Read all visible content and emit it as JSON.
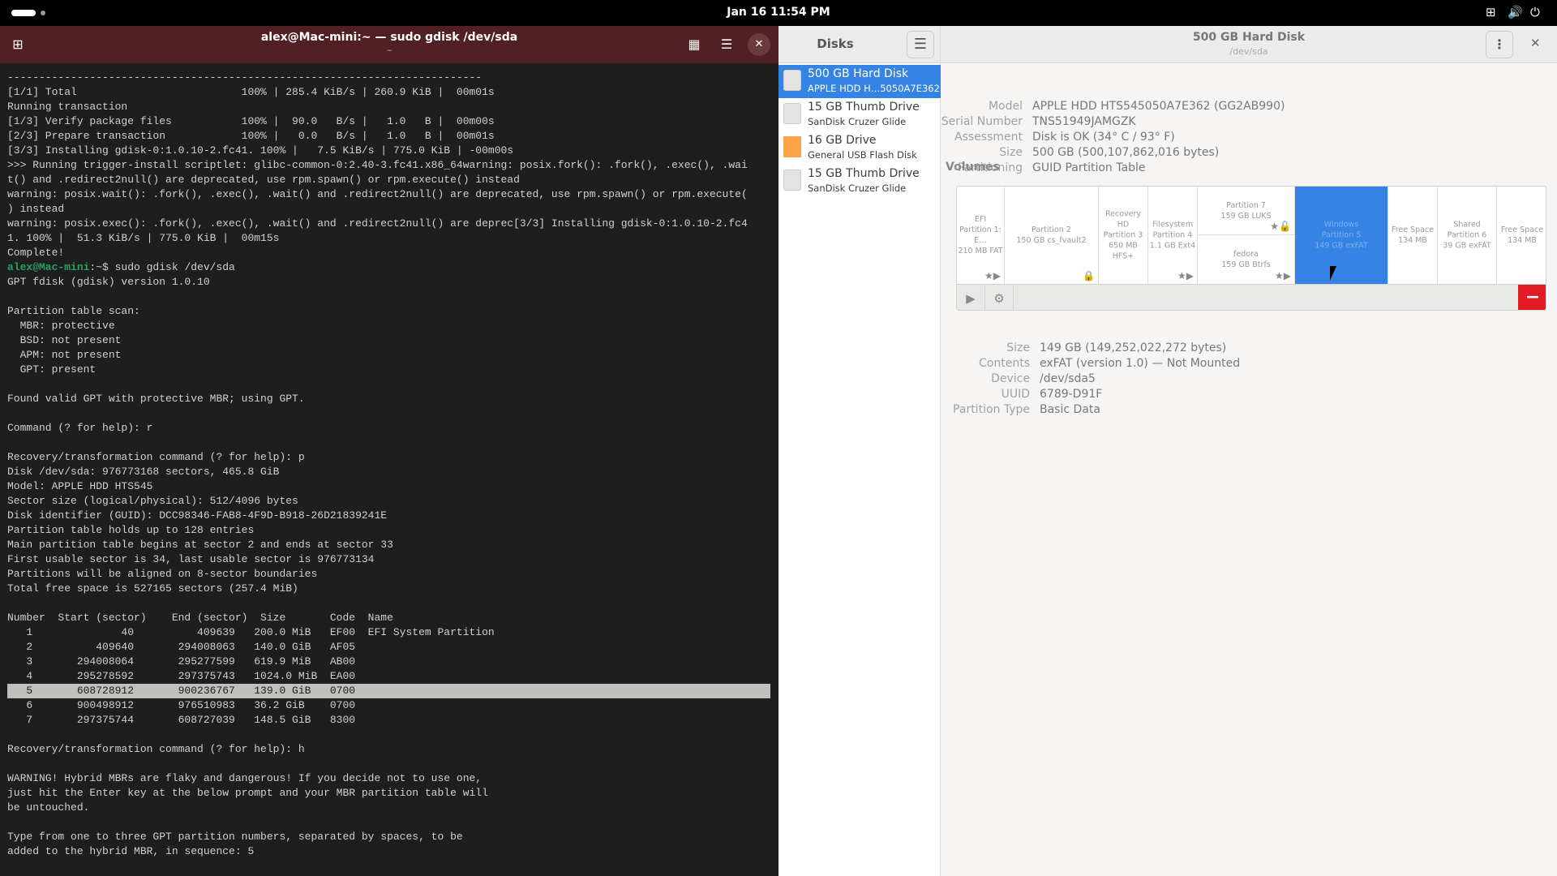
{
  "topbar": {
    "clock": "Jan 16  11:54 PM",
    "icons": [
      "activities-pill",
      "network-icon",
      "volume-icon",
      "power-icon"
    ]
  },
  "terminal": {
    "title": "alex@Mac-mini:~ — sudo gdisk /dev/sda",
    "subtitle": "~",
    "colors": {
      "titlebar": "#521f25",
      "background": "#1e1e1e",
      "prompt": "#26a269"
    },
    "lines": [
      "---------------------------------------------------------------------------",
      "[1/1] Total                          100% | 285.4 KiB/s | 260.9 KiB |  00m01s",
      "Running transaction",
      "[1/3] Verify package files           100% |  90.0   B/s |   1.0   B |  00m00s",
      "[2/3] Prepare transaction            100% |   0.0   B/s |   1.0   B |  00m01s",
      "[3/3] Installing gdisk-0:1.0.10-2.fc41. 100% |   7.5 KiB/s | 775.0 KiB | -00m00s",
      ">>> Running trigger-install scriptlet: glibc-common-0:2.40-3.fc41.x86_64warning: posix.fork(): .fork(), .exec(), .wai",
      "t() and .redirect2null() are deprecated, use rpm.spawn() or rpm.execute() instead",
      "warning: posix.wait(): .fork(), .exec(), .wait() and .redirect2null() are deprecated, use rpm.spawn() or rpm.execute(",
      ") instead",
      "warning: posix.exec(): .fork(), .exec(), .wait() and .redirect2null() are deprec[3/3] Installing gdisk-0:1.0.10-2.fc4",
      "1. 100% |  51.3 KiB/s | 775.0 KiB |  00m15s",
      "Complete!",
      {
        "user": "alex@Mac-mini",
        "sep": ":~$",
        "cmd": " sudo gdisk /dev/sda"
      },
      "GPT fdisk (gdisk) version 1.0.10",
      "",
      "Partition table scan:",
      "  MBR: protective",
      "  BSD: not present",
      "  APM: not present",
      "  GPT: present",
      "",
      "Found valid GPT with protective MBR; using GPT.",
      "",
      "Command (? for help): r",
      "",
      "Recovery/transformation command (? for help): p",
      "Disk /dev/sda: 976773168 sectors, 465.8 GiB",
      "Model: APPLE HDD HTS545",
      "Sector size (logical/physical): 512/4096 bytes",
      "Disk identifier (GUID): DCC98346-FAB8-4F9D-B918-26D21839241E",
      "Partition table holds up to 128 entries",
      "Main partition table begins at sector 2 and ends at sector 33",
      "First usable sector is 34, last usable sector is 976773134",
      "Partitions will be aligned on 8-sector boundaries",
      "Total free space is 527165 sectors (257.4 MiB)",
      "",
      "Number  Start (sector)    End (sector)  Size       Code  Name",
      "   1              40          409639   200.0 MiB   EF00  EFI System Partition",
      "   2          409640       294008063   140.0 GiB   AF05",
      "   3       294008064       295277599   619.9 MiB   AB00",
      "   4       295278592       297375743   1024.0 MiB  EA00",
      "   5       608728912       900236767   139.0 GiB   0700",
      "   6       900498912       976510983   36.2 GiB    0700",
      "   7       297375744       608727039   148.5 GiB   8300",
      "",
      "Recovery/transformation command (? for help): h",
      "",
      "WARNING! Hybrid MBRs are flaky and dangerous! If you decide not to use one,",
      "just hit the Enter key at the below prompt and your MBR partition table will",
      "be untouched.",
      "",
      "Type from one to three GPT partition numbers, separated by spaces, to be",
      "added to the hybrid MBR, in sequence: 5"
    ],
    "highlighted_line": 42
  },
  "disks": {
    "sidebar_title": "Disks",
    "accent": "#3584e4",
    "items": [
      {
        "name": "500 GB Hard Disk",
        "desc": "APPLE HDD H…5050A7E362",
        "selected": true,
        "icon": "hard-disk-icon"
      },
      {
        "name": "15 GB Thumb Drive",
        "desc": "SanDisk Cruzer Glide",
        "icon": "drive-icon"
      },
      {
        "name": "16 GB Drive",
        "desc": "General USB Flash Disk",
        "icon": "flash-drive-icon"
      },
      {
        "name": "15 GB Thumb Drive",
        "desc": "SanDisk Cruzer Glide",
        "icon": "drive-icon"
      }
    ],
    "header": {
      "title": "500 GB Hard Disk",
      "subtitle": "/dev/sda"
    },
    "info": [
      {
        "k": "Model",
        "v": "APPLE HDD HTS545050A7E362 (GG2AB990)"
      },
      {
        "k": "Serial Number",
        "v": "TNS51949JAMGZK"
      },
      {
        "k": "Assessment",
        "v": "Disk is OK (34° C / 93° F)"
      },
      {
        "k": "Size",
        "v": "500 GB (500,107,862,016 bytes)"
      },
      {
        "k": "Partitioning",
        "v": "GUID Partition Table"
      }
    ],
    "volumes_title": "Volumes",
    "partitions": [
      {
        "lines": [
          "EFI",
          "Partition 1: E…",
          "210 MB FAT"
        ],
        "icons": "★▶"
      },
      {
        "lines": [
          "Partition 2",
          "150 GB cs_fvault2"
        ],
        "icons": "🔒"
      },
      {
        "lines": [
          "Recovery HD",
          "Partition 3",
          "650 MB HFS+"
        ],
        "icons": ""
      },
      {
        "lines": [
          "Filesystem",
          "Partition 4",
          "1.1 GB Ext4"
        ],
        "icons": "★▶"
      },
      {
        "split": [
          {
            "lines": [
              "Partition 7",
              "159 GB LUKS"
            ],
            "icons": "★🔓"
          },
          {
            "lines": [
              "fedora",
              "159 GB Btrfs"
            ],
            "icons": "★▶"
          }
        ]
      },
      {
        "lines": [
          "Windows",
          "Partition 5",
          "149 GB exFAT"
        ],
        "icons": "",
        "selected": true
      },
      {
        "lines": [
          "Free Space",
          "134 MB"
        ],
        "icons": ""
      },
      {
        "lines": [
          "Shared",
          "Partition 6",
          "39 GB exFAT"
        ],
        "icons": ""
      },
      {
        "lines": [
          "Free Space",
          "134 MB"
        ],
        "icons": ""
      }
    ],
    "selected_info": [
      {
        "k": "Size",
        "v": "149 GB (149,252,022,272 bytes)"
      },
      {
        "k": "Contents",
        "v": "exFAT (version 1.0) — Not Mounted"
      },
      {
        "k": "Device",
        "v": "/dev/sda5"
      },
      {
        "k": "UUID",
        "v": "6789-D91F"
      },
      {
        "k": "Partition Type",
        "v": "Basic Data"
      }
    ]
  }
}
